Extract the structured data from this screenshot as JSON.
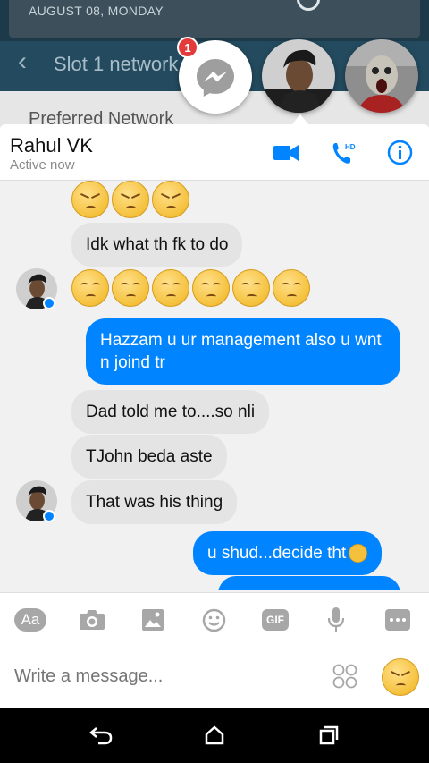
{
  "background": {
    "notification_date": "AUGUST 08, MONDAY",
    "screen_title": "Slot 1 network",
    "section_title": "Preferred Network"
  },
  "chat_heads": {
    "unread_badge": "1"
  },
  "header": {
    "contact_name": "Rahul VK",
    "status": "Active now",
    "video_icon": "video-call-icon",
    "call_icon": "hd-voice-call-icon",
    "info_icon": "info-icon",
    "accent": "#0084ff"
  },
  "messages": [
    {
      "sender": "them",
      "text": "Idk what th fk to do"
    },
    {
      "sender": "me",
      "text": "Hazzam u ur management also u wnt n joind tr"
    },
    {
      "sender": "them",
      "text": "Dad told me to....so nli"
    },
    {
      "sender": "them",
      "text": "TJohn beda aste"
    },
    {
      "sender": "them",
      "text": "That was his thing"
    },
    {
      "sender": "me",
      "text": "u shud...decide tht"
    }
  ],
  "toolbar": {
    "text_label": "Aa",
    "gif_label": "GIF"
  },
  "composer": {
    "placeholder": "Write a message..."
  },
  "colors": {
    "outgoing_bubble": "#0084ff",
    "incoming_bubble": "#e4e4e4",
    "badge": "#e33b3b"
  }
}
